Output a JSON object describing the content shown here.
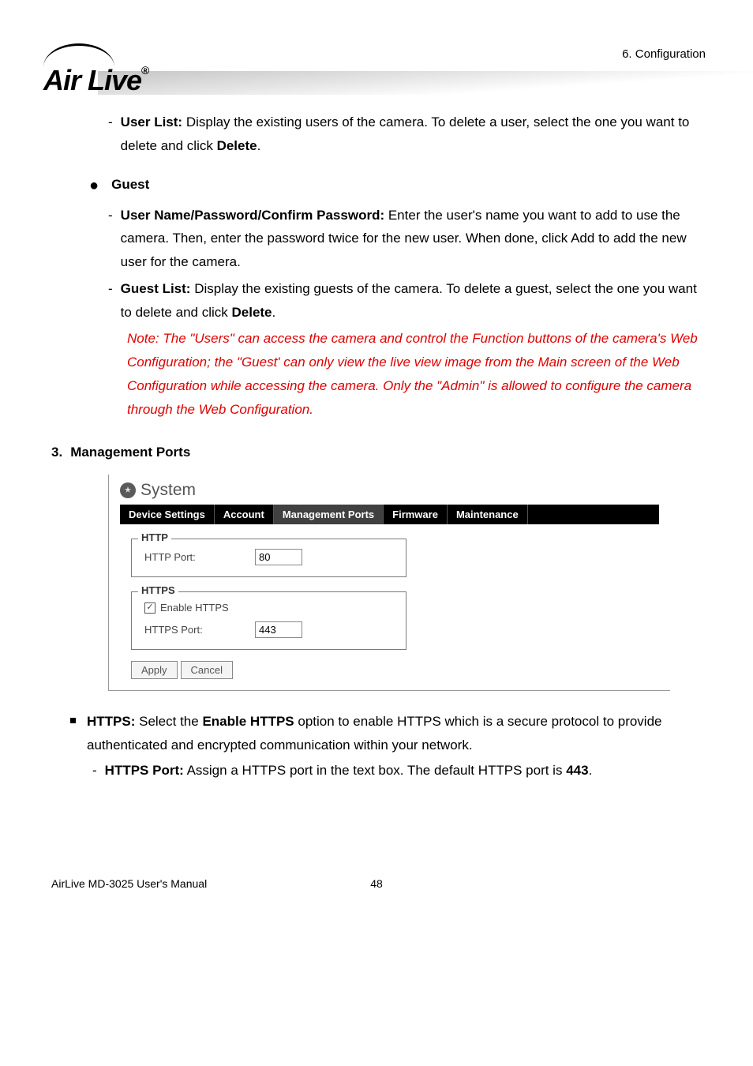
{
  "header": {
    "breadcrumb": "6. Configuration",
    "logo_text": "Air Live",
    "logo_reg": "®"
  },
  "section_user_list": {
    "dash": "-",
    "label": "User List:",
    "text": " Display the existing users of the camera. To delete a user, select the one you want to delete and click ",
    "delete": "Delete",
    "period": "."
  },
  "section_guest": {
    "bullet_label": "Guest",
    "item1_dash": "-",
    "item1_label": "User Name/Password/Confirm Password:",
    "item1_text": " Enter the user's name you want to add to use the camera. Then, enter the password twice for the new user. When done, click Add to add the new user for the camera.",
    "item2_dash": "-",
    "item2_label": "Guest List:",
    "item2_text": " Display the existing guests of the camera. To delete a guest, select the one you want to delete and click ",
    "item2_delete": "Delete",
    "item2_period": "."
  },
  "note": "Note: The \"Users\" can access the camera and control the Function buttons of the camera's Web Configuration; the \"Guest' can only view the live view image from the Main screen of the Web Configuration while accessing the camera. Only the \"Admin\" is allowed to configure the camera through the Web Configuration.",
  "heading3": {
    "num": "3.",
    "text": "Management Ports"
  },
  "screenshot": {
    "title": "System",
    "tabs": {
      "device": "Device Settings",
      "account": "Account",
      "mgmt": "Management Ports",
      "firmware": "Firmware",
      "maint": "Maintenance"
    },
    "http": {
      "legend": "HTTP",
      "label": "HTTP Port:",
      "value": "80"
    },
    "https": {
      "legend": "HTTPS",
      "enable_label": "Enable HTTPS",
      "port_label": "HTTPS Port:",
      "port_value": "443"
    },
    "buttons": {
      "apply": "Apply",
      "cancel": "Cancel"
    }
  },
  "section_https": {
    "label": "HTTPS:",
    "text1": " Select the ",
    "enable": "Enable HTTPS",
    "text2": " option to enable HTTPS which is a secure protocol to provide authenticated and encrypted communication within your network.",
    "port_dash": "-",
    "port_label": "HTTPS Port:",
    "port_text1": " Assign a HTTPS port in the text box. The default HTTPS port is ",
    "port_val": "443",
    "port_text2": "."
  },
  "footer": {
    "manual": "AirLive MD-3025 User's Manual",
    "page": "48"
  }
}
